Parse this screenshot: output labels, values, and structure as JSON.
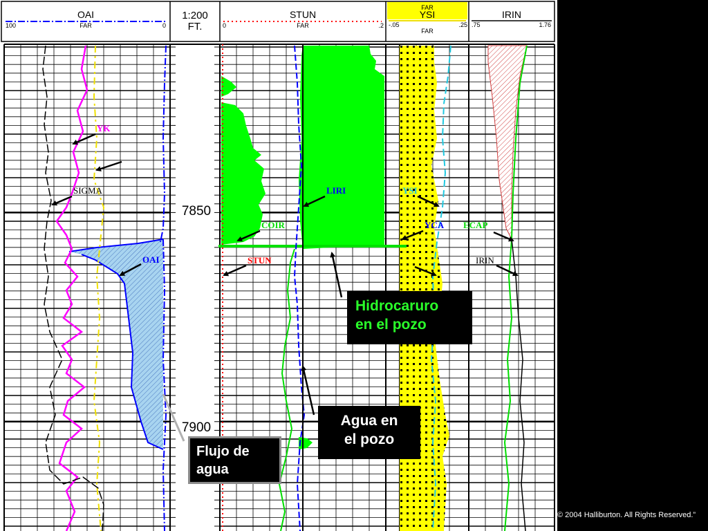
{
  "header": {
    "track1": {
      "curve": "OAI",
      "left_scale": "100",
      "right_scale": "0",
      "units": "FAR"
    },
    "depth": {
      "scale": "1:200",
      "units": "FT."
    },
    "track2": {
      "curve": "STUN",
      "left_scale": "0",
      "right_scale": ".2",
      "units": "FAR"
    },
    "track3": {
      "top_units": "FAR",
      "curve": "YSI",
      "left_scale": "-.05",
      "right_scale": ".25",
      "units": "FAR"
    },
    "track4": {
      "curve": "IRIN",
      "left_scale": ".75",
      "right_scale": "1.76"
    }
  },
  "depth_labels": [
    "7850",
    "7900"
  ],
  "annotations": {
    "yk": "YK",
    "sigma": "SIGMA",
    "oai": "OAI",
    "liri": "LIRI",
    "coir": "COIR",
    "stun": "STUN",
    "ysi": "YSI",
    "yca": "YCA",
    "ecap": "ECAP",
    "irin": "IRIN"
  },
  "callouts": {
    "hydrocarbon": [
      "Hidrocaruro",
      "en el pozo"
    ],
    "water": [
      "Agua en",
      "el pozo"
    ],
    "flow": [
      "Flujo de",
      "agua"
    ]
  },
  "colors": {
    "hydrocarbon_fill": "#00ff00",
    "ysi_fill": "#ffff00",
    "water_flow_fill": "#a8d4f0",
    "curve_magenta": "#ff00ff",
    "curve_blue": "#0000ff"
  },
  "copyright": "© 2004 Halliburton. All Rights Reserved.”"
}
